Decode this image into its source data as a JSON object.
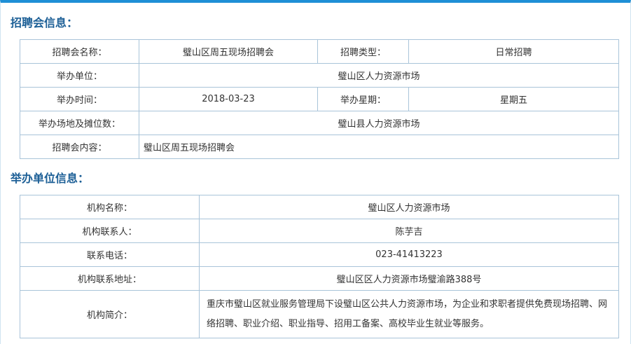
{
  "fair_section": {
    "title": "招聘会信息：",
    "rows": {
      "name_label": "招聘会名称：",
      "name_value": "璧山区周五现场招聘会",
      "type_label": "招聘类型：",
      "type_value": "日常招聘",
      "host_label": "举办单位：",
      "host_value": "璧山区人力资源市场",
      "date_label": "举办时间：",
      "date_value": "2018-03-23",
      "weekday_label": "举办星期：",
      "weekday_value": "星期五",
      "venue_label": "举办场地及摊位数：",
      "venue_value": "璧山县人力资源市场",
      "content_label": "招聘会内容：",
      "content_value": "璧山区周五现场招聘会"
    }
  },
  "org_section": {
    "title": "举办单位信息：",
    "rows": {
      "org_name_label": "机构名称：",
      "org_name_value": "璧山区人力资源市场",
      "contact_label": "机构联系人：",
      "contact_value": "陈芋吉",
      "phone_label": "联系电话：",
      "phone_value": "023-41413223",
      "address_label": "机构联系地址：",
      "address_value": "璧山区区人力资源市场璧渝路388号",
      "intro_label": "机构简介：",
      "intro_value": "重庆市璧山区就业服务管理局下设璧山区公共人力资源市场，为企业和求职者提供免费现场招聘、网络招聘、职业介绍、职业指导、招用工备案、高校毕业生就业等服务。"
    }
  }
}
